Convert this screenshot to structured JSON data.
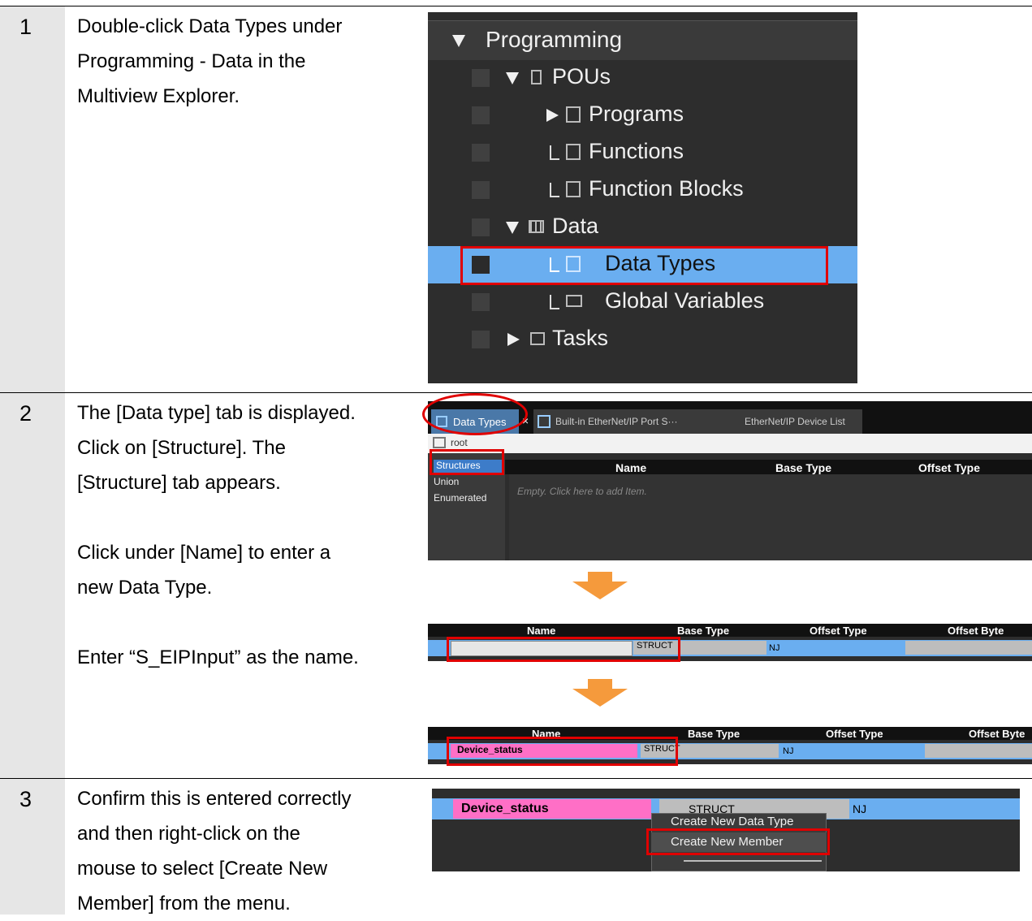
{
  "steps": [
    {
      "number": "1",
      "lines": [
        "Double-click Data Types under",
        "Programming - Data in the",
        "Multiview Explorer."
      ]
    },
    {
      "number": "2",
      "lines": [
        "The [Data type] tab is displayed.",
        "Click on [Structure]. The",
        "[Structure] tab appears."
      ],
      "lines2": [
        "Click under [Name] to enter a",
        "new Data Type."
      ],
      "lines3": [
        "Enter “S_EIPInput” as the name."
      ]
    },
    {
      "number": "3",
      "lines": [
        "Confirm this is entered correctly",
        "and then right-click on the",
        "mouse to select [Create New",
        "Member] from the menu."
      ]
    }
  ],
  "explorer": {
    "programming": "Programming",
    "pous": "POUs",
    "programs": "Programs",
    "functions": "Functions",
    "function_blocks": "Function Blocks",
    "data": "Data",
    "data_types": "Data Types",
    "global_variables": "Global Variables",
    "tasks": "Tasks"
  },
  "editor": {
    "tab_active": "Data Types",
    "tab_close": "×",
    "tab2": "Built-in EtherNet/IP Port S···",
    "tab3": "EtherNet/IP Device List",
    "root": "root",
    "side_structures": "Structures",
    "side_union": "Union",
    "side_enumerated": "Enumerated",
    "col_name": "Name",
    "col_base": "Base Type",
    "col_offset": "Offset Type",
    "empty_hint": "Empty. Click here to add Item."
  },
  "row_edit": {
    "col_name": "Name",
    "col_base": "Base Type",
    "col_offset": "Offset Type",
    "col_byte": "Offset Byte",
    "base_value": "STRUCT",
    "offset_value": "NJ"
  },
  "row_named": {
    "col_name": "Name",
    "col_base": "Base Type",
    "col_offset": "Offset Type",
    "col_byte": "Offset Byte",
    "name_value": "Device_status",
    "base_value": "STRUCT",
    "offset_value": "NJ"
  },
  "context": {
    "name_value": "Device_status",
    "base_value": "STRUCT",
    "offset_value": "NJ",
    "menu": [
      "Create New Data Type",
      "Create New Member"
    ]
  },
  "colors": {
    "highlight": "#e00000",
    "arrow": "#f59a3c",
    "selected_row": "#6aaef0",
    "pink": "#ff6fc6"
  }
}
